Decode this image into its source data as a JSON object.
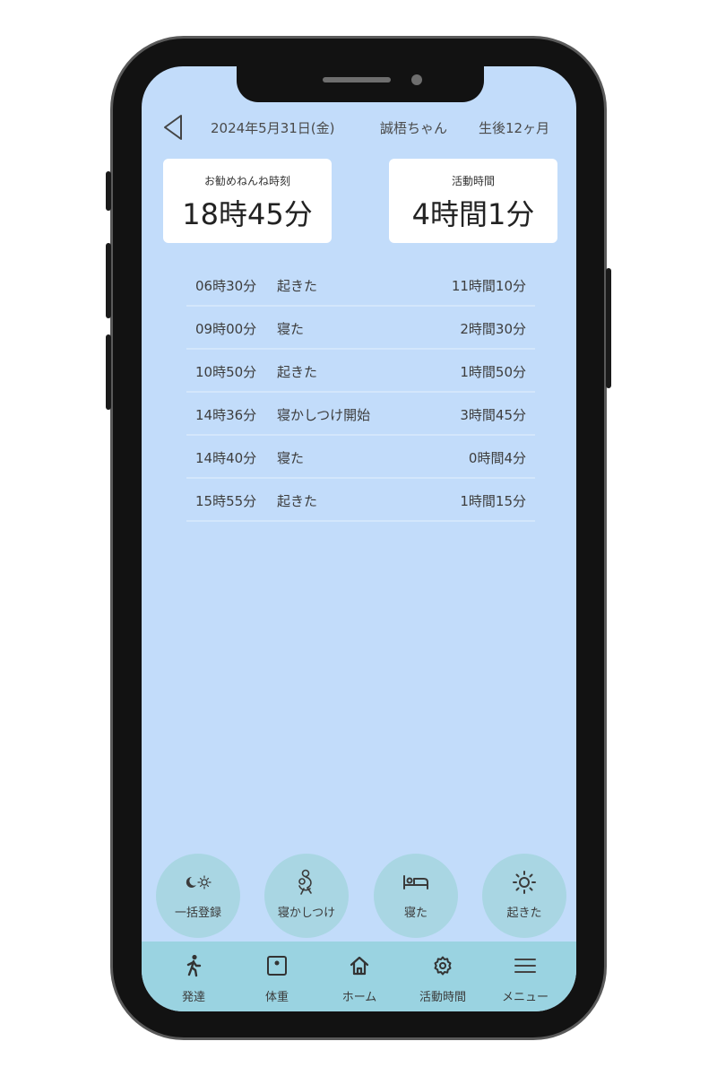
{
  "header": {
    "date": "2024年5月31日(金)",
    "child_name": "誠梧ちゃん",
    "age": "生後12ヶ月"
  },
  "cards": {
    "recommended_sleep": {
      "label": "お勧めねんね時刻",
      "value": "18時45分"
    },
    "activity_time": {
      "label": "活動時間",
      "value": "4時間1分"
    }
  },
  "log": [
    {
      "time": "06時30分",
      "event": "起きた",
      "duration": "11時間10分"
    },
    {
      "time": "09時00分",
      "event": "寝た",
      "duration": "2時間30分"
    },
    {
      "time": "10時50分",
      "event": "起きた",
      "duration": "1時間50分"
    },
    {
      "time": "14時36分",
      "event": "寝かしつけ開始",
      "duration": "3時間45分"
    },
    {
      "time": "14時40分",
      "event": "寝た",
      "duration": "0時間4分"
    },
    {
      "time": "15時55分",
      "event": "起きた",
      "duration": "1時間15分"
    }
  ],
  "actions": [
    {
      "label": "一括登録",
      "icon": "moon-sun-icon"
    },
    {
      "label": "寝かしつけ",
      "icon": "baby-holding-icon"
    },
    {
      "label": "寝た",
      "icon": "bed-icon"
    },
    {
      "label": "起きた",
      "icon": "sun-icon"
    }
  ],
  "tabs": [
    {
      "label": "発達",
      "icon": "walking-person-icon"
    },
    {
      "label": "体重",
      "icon": "scale-icon"
    },
    {
      "label": "ホーム",
      "icon": "home-icon"
    },
    {
      "label": "活動時間",
      "icon": "gear-icon"
    },
    {
      "label": "メニュー",
      "icon": "hamburger-menu-icon"
    }
  ],
  "colors": {
    "screen_background": "#c2dcfa",
    "action_button": "#a9d6e3",
    "tab_bar": "#9ad3e1",
    "card_background": "#ffffff"
  }
}
